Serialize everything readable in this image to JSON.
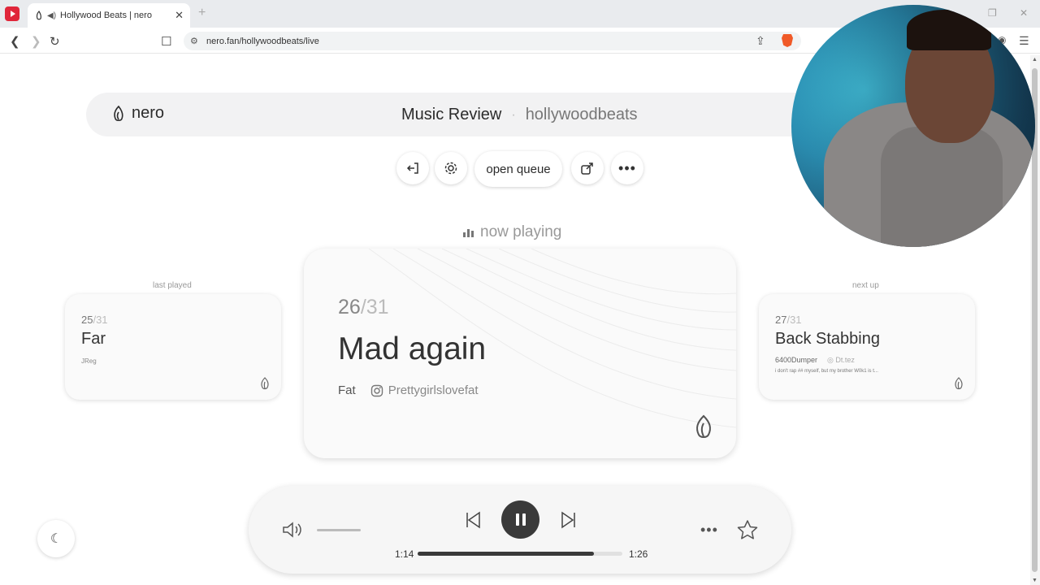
{
  "browser": {
    "tab_title": "Hollywood Beats | nero",
    "new_tab": "+",
    "url": "nero.fan/hollywoodbeats/live"
  },
  "header": {
    "logo_text": "nero",
    "title": "Music Review",
    "separator": "·",
    "channel": "hollywoodbeats"
  },
  "toolbar": {
    "queue_label": "open queue"
  },
  "now_playing": {
    "label": "now playing",
    "number": "26",
    "total": "/31",
    "title": "Mad again",
    "artist": "Fat",
    "instagram": "Prettygirlslovefat"
  },
  "last_played": {
    "label": "last played",
    "number": "25",
    "total": "/31",
    "title": "Far",
    "artist": "JReg"
  },
  "next_up": {
    "label": "next up",
    "number": "27",
    "total": "/31",
    "title": "Back Stabbing",
    "artist": "6400Dumper",
    "instagram": "Dt.tez",
    "description": "i don't rap ## myself, but my brother W0k1 is t..."
  },
  "player": {
    "current_time": "1:14",
    "total_time": "1:26",
    "progress": 0.86,
    "volume": 0.5
  },
  "colors": {
    "accent": "#3a3a3a",
    "brave": "#f05a28",
    "youtube": "#e0263a"
  },
  "icons": [
    "exit-icon",
    "settings-icon",
    "share-icon",
    "more-icon",
    "volume-icon",
    "previous-icon",
    "pause-icon",
    "next-icon",
    "star-icon",
    "moon-icon",
    "flame-icon",
    "instagram-icon"
  ]
}
